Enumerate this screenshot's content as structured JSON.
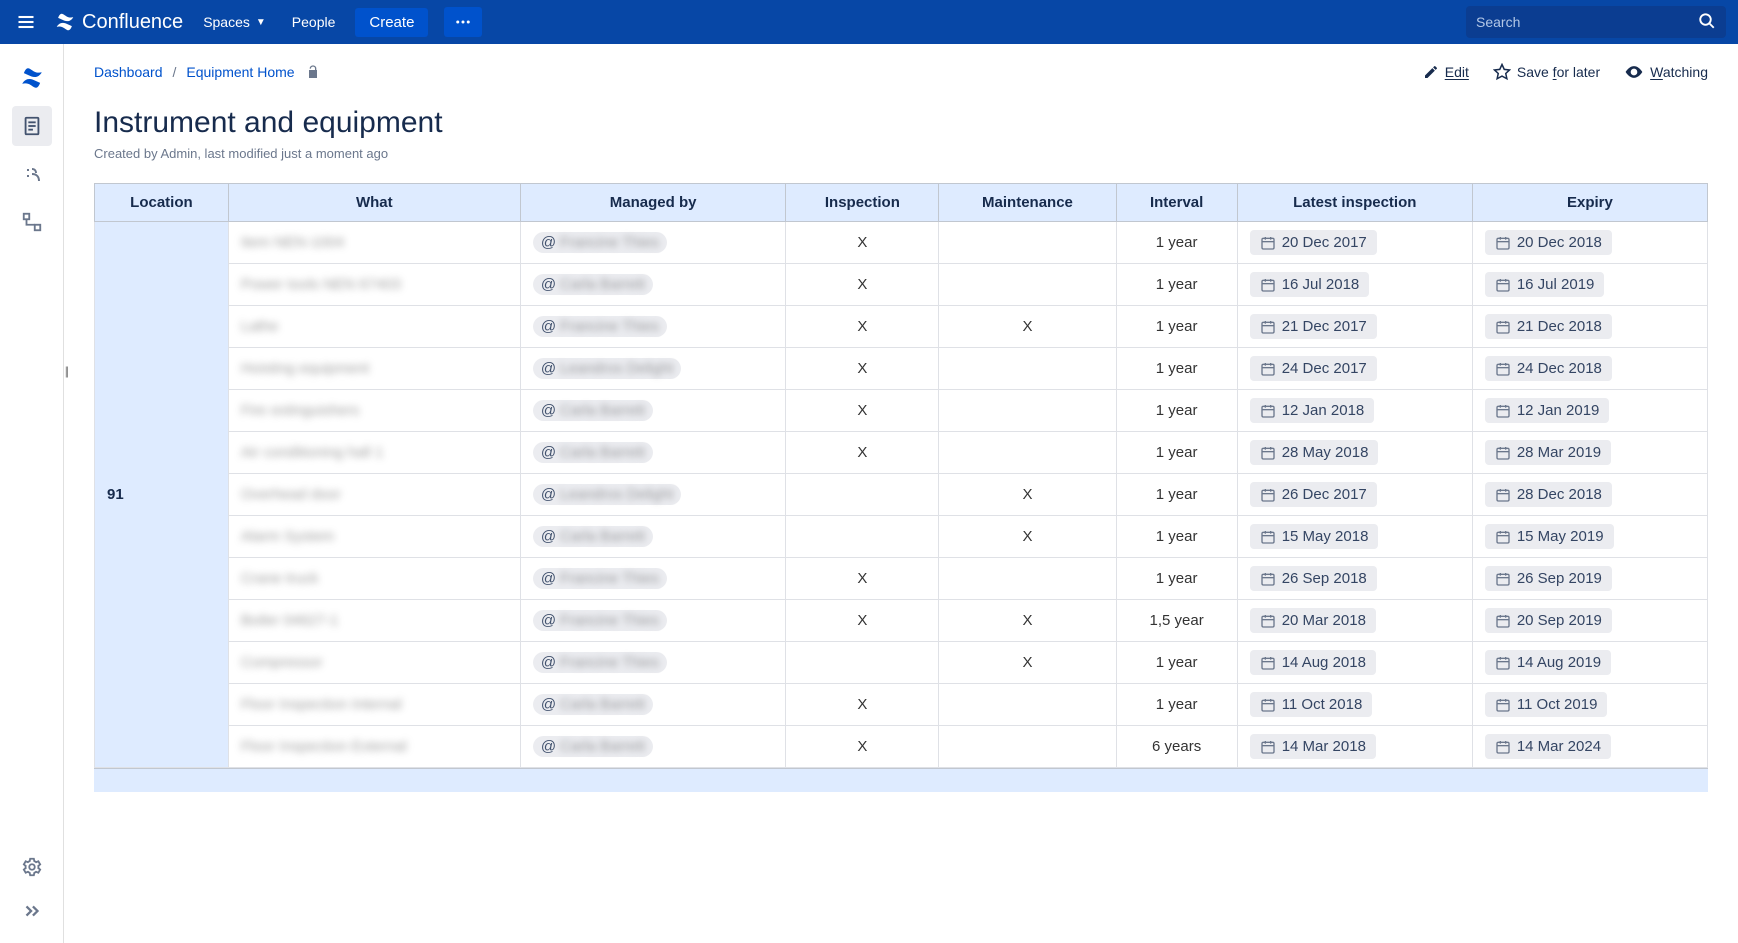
{
  "topbar": {
    "product": "Confluence",
    "spaces_label": "Spaces",
    "people_label": "People",
    "create_label": "Create",
    "search_placeholder": "Search"
  },
  "breadcrumb": {
    "items": [
      "Dashboard",
      "Equipment Home"
    ]
  },
  "page_actions": {
    "edit": "Edit",
    "save_for_later": "Save for later",
    "save_for_later_prefix": "Save ",
    "save_for_later_ul": "f",
    "save_for_later_suffix": "or later",
    "watching": "Watching",
    "watching_prefix": "",
    "watching_ul": "W",
    "watching_suffix": "atching"
  },
  "page": {
    "title": "Instrument and equipment",
    "byline": "Created by Admin, last modified just a moment ago"
  },
  "table": {
    "headers": [
      "Location",
      "What",
      "Managed by",
      "Inspection",
      "Maintenance",
      "Interval",
      "Latest inspection",
      "Expiry"
    ],
    "location": "91",
    "rows": [
      {
        "what": "Item NEN-1004",
        "managed_by": "Francine Thies",
        "inspection": "X",
        "maintenance": "",
        "interval": "1 year",
        "latest": "20 Dec 2017",
        "expiry": "20 Dec 2018"
      },
      {
        "what": "Power tools NEN 67403",
        "managed_by": "Carla Barrett",
        "inspection": "X",
        "maintenance": "",
        "interval": "1 year",
        "latest": "16 Jul 2018",
        "expiry": "16 Jul 2019"
      },
      {
        "what": "Lathe",
        "managed_by": "Francine Thies",
        "inspection": "X",
        "maintenance": "X",
        "interval": "1 year",
        "latest": "21 Dec 2017",
        "expiry": "21 Dec 2018"
      },
      {
        "what": "Hoisting equipment",
        "managed_by": "Leandros Delight",
        "inspection": "X",
        "maintenance": "",
        "interval": "1 year",
        "latest": "24 Dec 2017",
        "expiry": "24 Dec 2018"
      },
      {
        "what": "Fire extinguishers",
        "managed_by": "Carla Barrett",
        "inspection": "X",
        "maintenance": "",
        "interval": "1 year",
        "latest": "12 Jan 2018",
        "expiry": "12 Jan 2019"
      },
      {
        "what": "Air conditioning hall 1",
        "managed_by": "Carla Barrett",
        "inspection": "X",
        "maintenance": "",
        "interval": "1 year",
        "latest": "28 May 2018",
        "expiry": "28 Mar 2019"
      },
      {
        "what": "Overhead door",
        "managed_by": "Leandros Delight",
        "inspection": "",
        "maintenance": "X",
        "interval": "1 year",
        "latest": "26 Dec 2017",
        "expiry": "28 Dec 2018"
      },
      {
        "what": "Alarm System",
        "managed_by": "Carla Barrett",
        "inspection": "",
        "maintenance": "X",
        "interval": "1 year",
        "latest": "15 May 2018",
        "expiry": "15 May 2019"
      },
      {
        "what": "Crane truck",
        "managed_by": "Francine Thies",
        "inspection": "X",
        "maintenance": "",
        "interval": "1 year",
        "latest": "26 Sep 2018",
        "expiry": "26 Sep 2019"
      },
      {
        "what": "Boiler 04627-1",
        "managed_by": "Francine Thies",
        "inspection": "X",
        "maintenance": "X",
        "interval": "1,5 year",
        "latest": "20 Mar 2018",
        "expiry": "20 Sep 2019"
      },
      {
        "what": "Compressor",
        "managed_by": "Francine Thies",
        "inspection": "",
        "maintenance": "X",
        "interval": "1 year",
        "latest": "14 Aug 2018",
        "expiry": "14 Aug 2019"
      },
      {
        "what": "Floor Inspection Internal",
        "managed_by": "Carla Barrett",
        "inspection": "X",
        "maintenance": "",
        "interval": "1 year",
        "latest": "11 Oct 2018",
        "expiry": "11 Oct 2019"
      },
      {
        "what": "Floor Inspection External",
        "managed_by": "Carla Barrett",
        "inspection": "X",
        "maintenance": "",
        "interval": "6 years",
        "latest": "14 Mar 2018",
        "expiry": "14 Mar 2024"
      }
    ]
  }
}
